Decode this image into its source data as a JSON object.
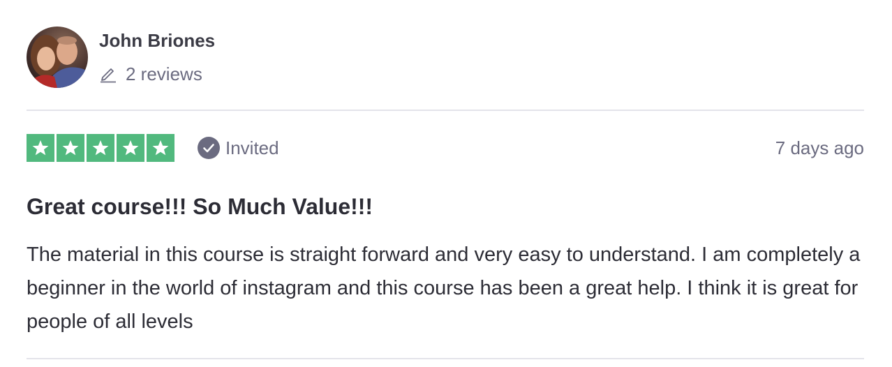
{
  "reviewer": {
    "name": "John Briones",
    "review_count": "2 reviews",
    "avatar_icon": "reviewer-avatar-photo"
  },
  "rating": {
    "stars": 5,
    "max_stars": 5,
    "star_color": "#51b97e",
    "status_label": "Invited",
    "status_icon": "check-circle-icon",
    "date": "7 days ago"
  },
  "review": {
    "title": "Great course!!! So Much Value!!!",
    "body": "The material in this course is straight forward and very easy to understand. I am completely a beginner in the world of instagram and this course has been a great help. I think it is great for people of all levels"
  }
}
